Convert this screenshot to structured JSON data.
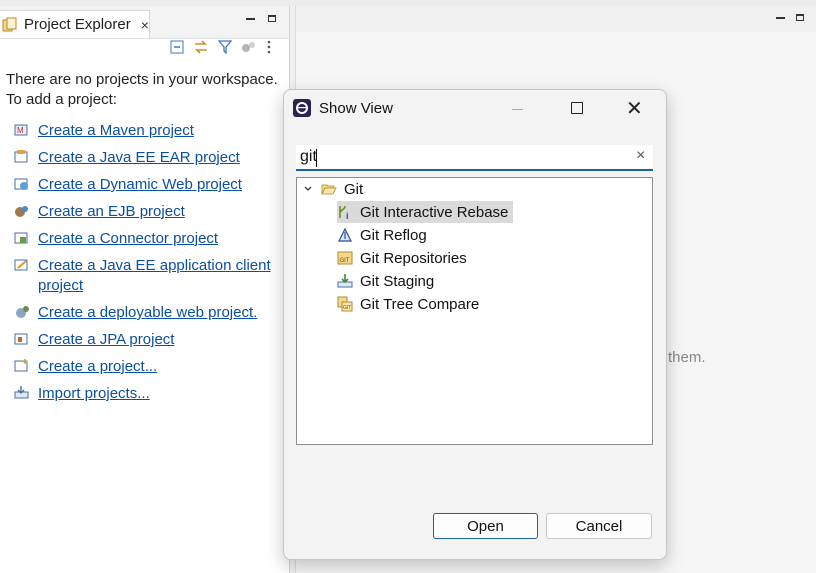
{
  "project_explorer": {
    "tab_title": "Project Explorer",
    "tab_close": "×",
    "empty_message_line1": "There are no projects in your workspace.",
    "empty_message_line2": "To add a project:",
    "links": [
      {
        "label": "Create a Maven project",
        "icon": "maven-project-icon"
      },
      {
        "label": "Create a Java EE EAR project",
        "icon": "ear-project-icon"
      },
      {
        "label": "Create a Dynamic Web project",
        "icon": "web-project-icon"
      },
      {
        "label": "Create an EJB project",
        "icon": "ejb-project-icon"
      },
      {
        "label": "Create a Connector project",
        "icon": "connector-project-icon"
      },
      {
        "label": "Create a Java EE application client project",
        "icon": "app-client-project-icon"
      },
      {
        "label": "Create a deployable web project.",
        "icon": "deployable-web-project-icon"
      },
      {
        "label": "Create a JPA project",
        "icon": "jpa-project-icon"
      },
      {
        "label": "Create a project...",
        "icon": "new-project-icon"
      },
      {
        "label": "Import projects...",
        "icon": "import-projects-icon"
      }
    ]
  },
  "background": {
    "partial_text": "them."
  },
  "dialog": {
    "title": "Show View",
    "filter_value": "git",
    "filter_clear": "×",
    "tree": {
      "category": "Git",
      "items": [
        {
          "label": "Git Interactive Rebase",
          "icon": "git-interactive-rebase-icon",
          "selected": true
        },
        {
          "label": "Git Reflog",
          "icon": "git-reflog-icon",
          "selected": false
        },
        {
          "label": "Git Repositories",
          "icon": "git-repositories-icon",
          "selected": false
        },
        {
          "label": "Git Staging",
          "icon": "git-staging-icon",
          "selected": false
        },
        {
          "label": "Git Tree Compare",
          "icon": "git-tree-compare-icon",
          "selected": false
        }
      ]
    },
    "open_label": "Open",
    "cancel_label": "Cancel"
  },
  "colors": {
    "link": "#0b4fa0",
    "focus_accent": "#1f5fa8",
    "selection": "#dadada"
  }
}
